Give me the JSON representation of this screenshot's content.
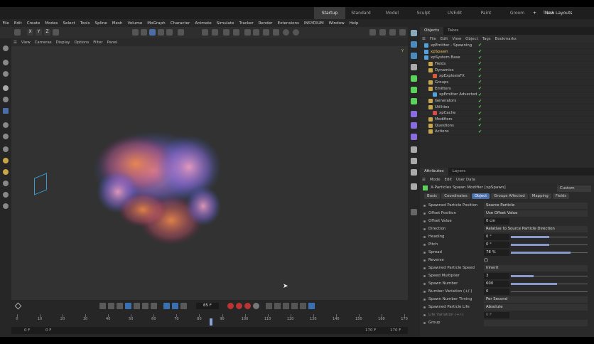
{
  "layouts": [
    "Startup",
    "Standard",
    "Model",
    "Sculpt",
    "UVEdit",
    "Paint",
    "Groom",
    "Track"
  ],
  "new_layouts": "New Layouts",
  "menu": [
    "File",
    "Edit",
    "Create",
    "Modes",
    "Select",
    "Tools",
    "Spline",
    "Mesh",
    "Volume",
    "MoGraph",
    "Character",
    "Animate",
    "Simulate",
    "Tracker",
    "Render",
    "Extensions",
    "INSYDIUM",
    "Window",
    "Help"
  ],
  "axis_lock": [
    "X",
    "Y",
    "Z"
  ],
  "viewport_menu": [
    "View",
    "Cameras",
    "Display",
    "Options",
    "Filter",
    "Panel"
  ],
  "viewport_axis": "Y",
  "timeline": {
    "frame": "85 F",
    "ticks": [
      "0",
      "10",
      "20",
      "30",
      "40",
      "50",
      "60",
      "70",
      "80",
      "90",
      "100",
      "110",
      "120",
      "130",
      "140",
      "150",
      "160",
      "170"
    ],
    "range_start": "0 F",
    "range_start2": "0 F",
    "range_end": "170 F",
    "range_end2": "170 F",
    "playhead_frame": 85,
    "max_frame": 170
  },
  "objects_panel": {
    "tabs": [
      "Objects",
      "Takes"
    ],
    "menu": [
      "File",
      "Edit",
      "View",
      "Object",
      "Tags",
      "Bookmarks"
    ],
    "items": [
      {
        "label": "xpEmitter - Spawning",
        "indent": 0,
        "color": "#4fa3e0"
      },
      {
        "label": "xpSpawn",
        "indent": 0,
        "color": "#4fa3e0",
        "selected": true
      },
      {
        "label": "xpSystem Base",
        "indent": 0,
        "color": "#4fa3e0"
      },
      {
        "label": "Fields",
        "indent": 1,
        "color": "#c9a64a"
      },
      {
        "label": "Dynamics",
        "indent": 1,
        "color": "#c9a64a"
      },
      {
        "label": "xpExplosiaFX",
        "indent": 2,
        "color": "#d65c3a"
      },
      {
        "label": "Groups",
        "indent": 1,
        "color": "#c9a64a"
      },
      {
        "label": "Emitters",
        "indent": 1,
        "color": "#c9a64a"
      },
      {
        "label": "xpEmitter Advected",
        "indent": 2,
        "color": "#4fa3e0"
      },
      {
        "label": "Generators",
        "indent": 1,
        "color": "#c9a64a"
      },
      {
        "label": "Utilities",
        "indent": 1,
        "color": "#c9a64a"
      },
      {
        "label": "xpCache",
        "indent": 2,
        "color": "#d64a4a"
      },
      {
        "label": "Modifiers",
        "indent": 1,
        "color": "#c9a64a"
      },
      {
        "label": "Questions",
        "indent": 1,
        "color": "#c9a64a"
      },
      {
        "label": "Actions",
        "indent": 1,
        "color": "#c9a64a"
      }
    ]
  },
  "attributes_panel": {
    "tabs": [
      "Attributes",
      "Layers"
    ],
    "menu": [
      "Mode",
      "Edit",
      "User Data"
    ],
    "modifier_title": "X-Particles Spawn Modifier [xpSpawn]",
    "preset": "Custom",
    "attr_tabs": [
      "Basic",
      "Coordinates",
      "Object",
      "Groups Affected",
      "Mapping",
      "Fields"
    ],
    "active_tab": "Object",
    "rows": [
      {
        "label": "Spawned Particle Position",
        "value": "Source Particle",
        "type": "dropdown"
      },
      {
        "label": "Offset Position",
        "value": "Use Offset Value",
        "type": "dropdown"
      },
      {
        "label": "Offset Value",
        "value": "0 cm",
        "type": "number"
      },
      {
        "label": "Direction",
        "value": "Relative to Source Particle Direction",
        "type": "dropdown"
      },
      {
        "label": "Heading",
        "value": "0 °",
        "type": "slider",
        "fill": 0.5
      },
      {
        "label": "Pitch",
        "value": "0 °",
        "type": "slider",
        "fill": 0.5
      },
      {
        "label": "Spread",
        "value": "78 %",
        "type": "slider",
        "fill": 0.78
      },
      {
        "label": "Reverse",
        "value": "",
        "type": "check"
      },
      {
        "label": "Spawned Particle Speed",
        "value": "Inherit",
        "type": "dropdown"
      },
      {
        "label": "Speed Multiplier",
        "value": "3",
        "type": "slider",
        "fill": 0.3
      },
      {
        "label": "Spawn Number",
        "value": "600",
        "type": "slider",
        "fill": 0.6
      },
      {
        "label": "Number Variation (+/-)",
        "value": "0",
        "type": "slider",
        "fill": 0.0
      },
      {
        "label": "Spawn Number Timing",
        "value": "Per Second",
        "type": "dropdown"
      },
      {
        "label": "Spawned Particle Life",
        "value": "Absolute",
        "type": "dropdown"
      },
      {
        "label": "Life Variation (+/-)",
        "value": "0 F",
        "type": "number",
        "dim": true
      },
      {
        "label": "Group",
        "value": "",
        "type": "dropdown"
      }
    ]
  }
}
